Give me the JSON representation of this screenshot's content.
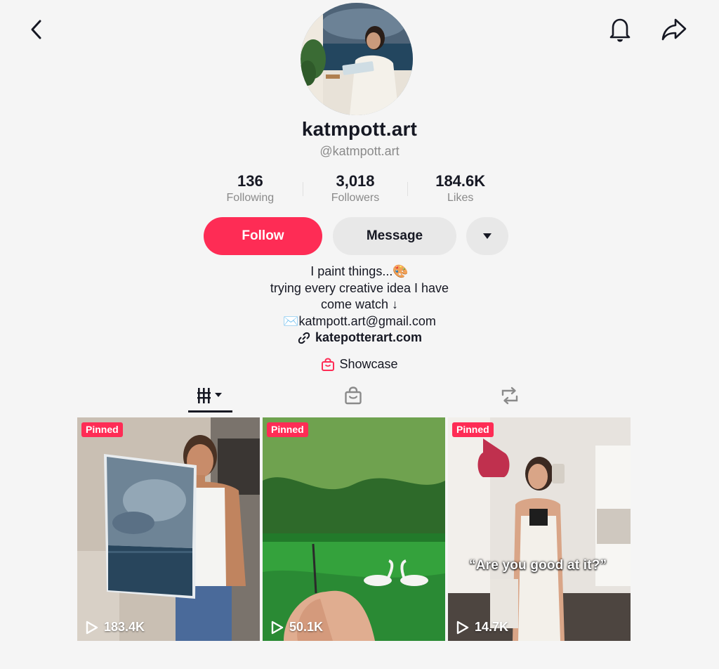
{
  "header": {
    "back_icon": "chevron-left-icon",
    "bell_icon": "bell-icon",
    "share_icon": "share-arrow-icon"
  },
  "profile": {
    "display_name": "katmpott.art",
    "handle": "@katmpott.art"
  },
  "stats": [
    {
      "value": "136",
      "label": "Following"
    },
    {
      "value": "3,018",
      "label": "Followers"
    },
    {
      "value": "184.6K",
      "label": "Likes"
    }
  ],
  "actions": {
    "follow_label": "Follow",
    "message_label": "Message",
    "more_icon": "caret-down-icon"
  },
  "bio": {
    "line1": "I paint things...🎨",
    "line2": "trying every creative idea I have",
    "line3": "come watch ↓",
    "line4": "✉️katmpott.art@gmail.com",
    "link": "katepotterart.com"
  },
  "showcase": {
    "label": "Showcase"
  },
  "tabs": [
    {
      "icon": "videos-grid-icon",
      "active": true
    },
    {
      "icon": "shop-bag-icon",
      "active": false
    },
    {
      "icon": "repost-icon",
      "active": false
    }
  ],
  "videos": [
    {
      "pinned": "Pinned",
      "views": "183.4K",
      "caption": ""
    },
    {
      "pinned": "Pinned",
      "views": "50.1K",
      "caption": ""
    },
    {
      "pinned": "Pinned",
      "views": "14.7K",
      "caption": "“Are you good at it?”"
    }
  ],
  "colors": {
    "accent": "#fe2c55",
    "background": "#f5f5f5",
    "text": "#161823",
    "muted": "#8a8a8a"
  }
}
